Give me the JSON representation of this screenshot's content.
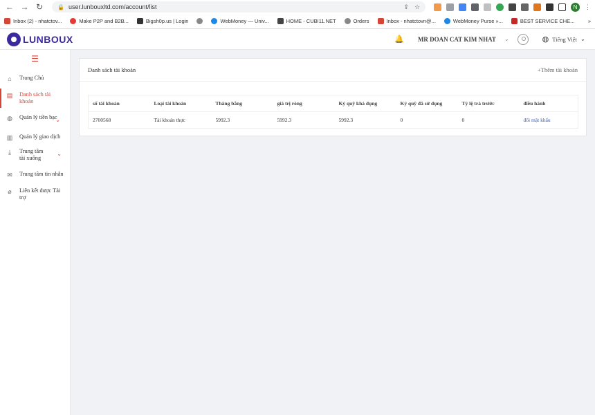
{
  "browser": {
    "url": "user.lunbouxltd.com/account/list",
    "profile_initial": "N",
    "bookmarks": [
      {
        "label": "Inbox (2) - nhatctov...",
        "color": "#d44638"
      },
      {
        "label": "Make P2P and B2B...",
        "color": "#e53935"
      },
      {
        "label": "Bigsh0p.us | Login",
        "color": "#333333"
      },
      {
        "label": "WebMoney — Univ...",
        "color": "#1e88e5"
      },
      {
        "label": "HOME - CUBI11.NET",
        "color": "#444444"
      },
      {
        "label": "Orders",
        "color": "#555555"
      },
      {
        "label": "Inbox - nhatctovn@...",
        "color": "#d44638"
      },
      {
        "label": "WebMoney Purse »...",
        "color": "#1e88e5"
      },
      {
        "label": "BEST SERVICE CHE...",
        "color": "#c62828"
      }
    ],
    "more": "»"
  },
  "header": {
    "logo_text": "LUNBOUX",
    "user_name": "MR DOAN CAT KIM NHAT",
    "language": "Tiếng Việt"
  },
  "sidebar": {
    "items": [
      {
        "label": "Trang Chủ",
        "icon": "home-icon"
      },
      {
        "label": "Danh sách tài khoản",
        "icon": "list-icon"
      },
      {
        "label": "Quản lý tiền bạc",
        "icon": "globe-icon"
      },
      {
        "label": "Quản lý giao dịch",
        "icon": "barcode-icon"
      },
      {
        "label": "Trung tâm tài xuống",
        "icon": "download-icon"
      },
      {
        "label": "Trung tâm tin nhắn",
        "icon": "mail-icon"
      },
      {
        "label": "Liên kết được Tài trợ",
        "icon": "paperclip-icon"
      }
    ]
  },
  "main": {
    "title": "Danh sách tài khoản",
    "add_link": "+Thêm tài khoản",
    "table": {
      "headers": [
        "số tài khoản",
        "Loại tài khoản",
        "Thăng bằng",
        "giá trị ròng",
        "Ký quỹ khả dụng",
        "Ký quỹ đã sử dụng",
        "Tỷ lệ trả trước",
        "điều hành"
      ],
      "rows": [
        [
          "2700568",
          "Tài khoản thực",
          "5992.3",
          "5992.3",
          "5992.3",
          "0",
          "0",
          "đổi mật khẩu"
        ]
      ]
    }
  },
  "colors": {
    "brand": "#3b2a9c",
    "accent": "#d4453a",
    "link": "#3a5da8"
  }
}
